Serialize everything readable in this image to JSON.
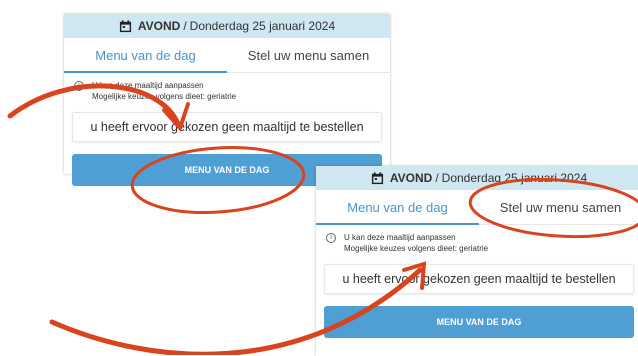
{
  "panels": [
    {
      "header": {
        "meal": "AVOND",
        "separator": "/",
        "date": "Donderdag 25 januari 2024"
      },
      "tabs": [
        "Menu van de dag",
        "Stel uw menu samen"
      ],
      "info": {
        "line1": "U kan deze maaltijd aanpassen",
        "line2": "Mogelijke keuzes volgens dieet: geriatrie"
      },
      "order_message": "u heeft ervoor gekozen geen maaltijd te bestellen",
      "menu_button": "MENU VAN DE DAG"
    },
    {
      "header": {
        "meal": "AVOND",
        "separator": "/",
        "date": "Donderdag 25 januari 2024"
      },
      "tabs": [
        "Menu van de dag",
        "Stel uw menu samen"
      ],
      "info": {
        "line1": "U kan deze maaltijd aanpassen",
        "line2": "Mogelijke keuzes volgens dieet: geriatrie"
      },
      "order_message": "u heeft ervoor gekozen geen maaltijd te bestellen",
      "menu_button": "MENU VAN DE DAG"
    }
  ],
  "colors": {
    "header_bg": "#cfe7f0",
    "accent": "#4a93c9",
    "button_bg": "#4f9fd5",
    "annotation": "#d8441e"
  }
}
